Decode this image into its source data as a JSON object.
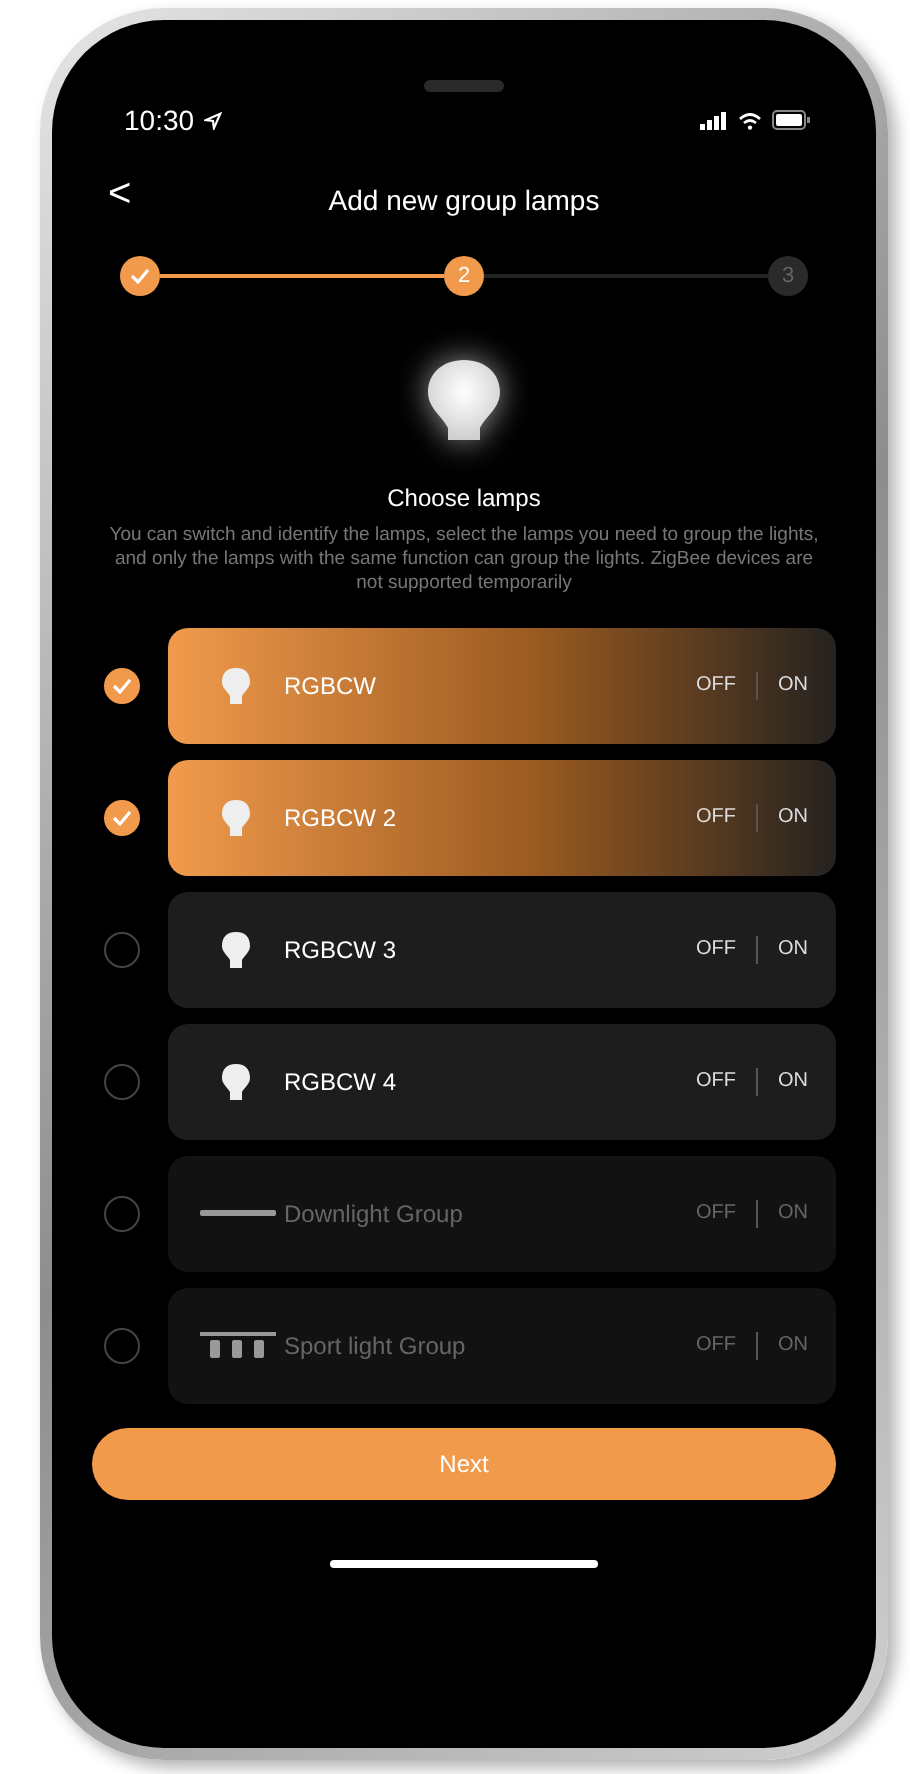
{
  "status_bar": {
    "time": "10:30"
  },
  "header": {
    "back": "<",
    "title": "Add new group lamps"
  },
  "steps": [
    {
      "completed": true,
      "selected": false
    },
    {
      "label": "2",
      "completed": false,
      "selected": true
    },
    {
      "label": "3",
      "completed": false,
      "selected": false
    }
  ],
  "intro": {
    "title": "Choose lamps",
    "description": "You can switch and identify the lamps, select the lamps you need to group the lights, and only the lamps with the same function can group the lights. ZigBee devices are not supported temporarily"
  },
  "lamps": [
    {
      "name": "RGBCW",
      "kind": "bulb",
      "selected": true,
      "disabled": false,
      "off": "OFF",
      "on": "ON"
    },
    {
      "name": "RGBCW 2",
      "kind": "bulb",
      "selected": true,
      "disabled": false,
      "off": "OFF",
      "on": "ON"
    },
    {
      "name": "RGBCW 3",
      "kind": "bulb",
      "selected": false,
      "disabled": false,
      "off": "OFF",
      "on": "ON"
    },
    {
      "name": "RGBCW 4",
      "kind": "bulb",
      "selected": false,
      "disabled": false,
      "off": "OFF",
      "on": "ON"
    },
    {
      "name": "Downlight Group",
      "kind": "downlight",
      "selected": false,
      "disabled": true,
      "off": "OFF",
      "on": "ON"
    },
    {
      "name": "Sport light Group",
      "kind": "spotlight",
      "selected": false,
      "disabled": true,
      "off": "OFF",
      "on": "ON"
    }
  ],
  "next_button": "Next"
}
